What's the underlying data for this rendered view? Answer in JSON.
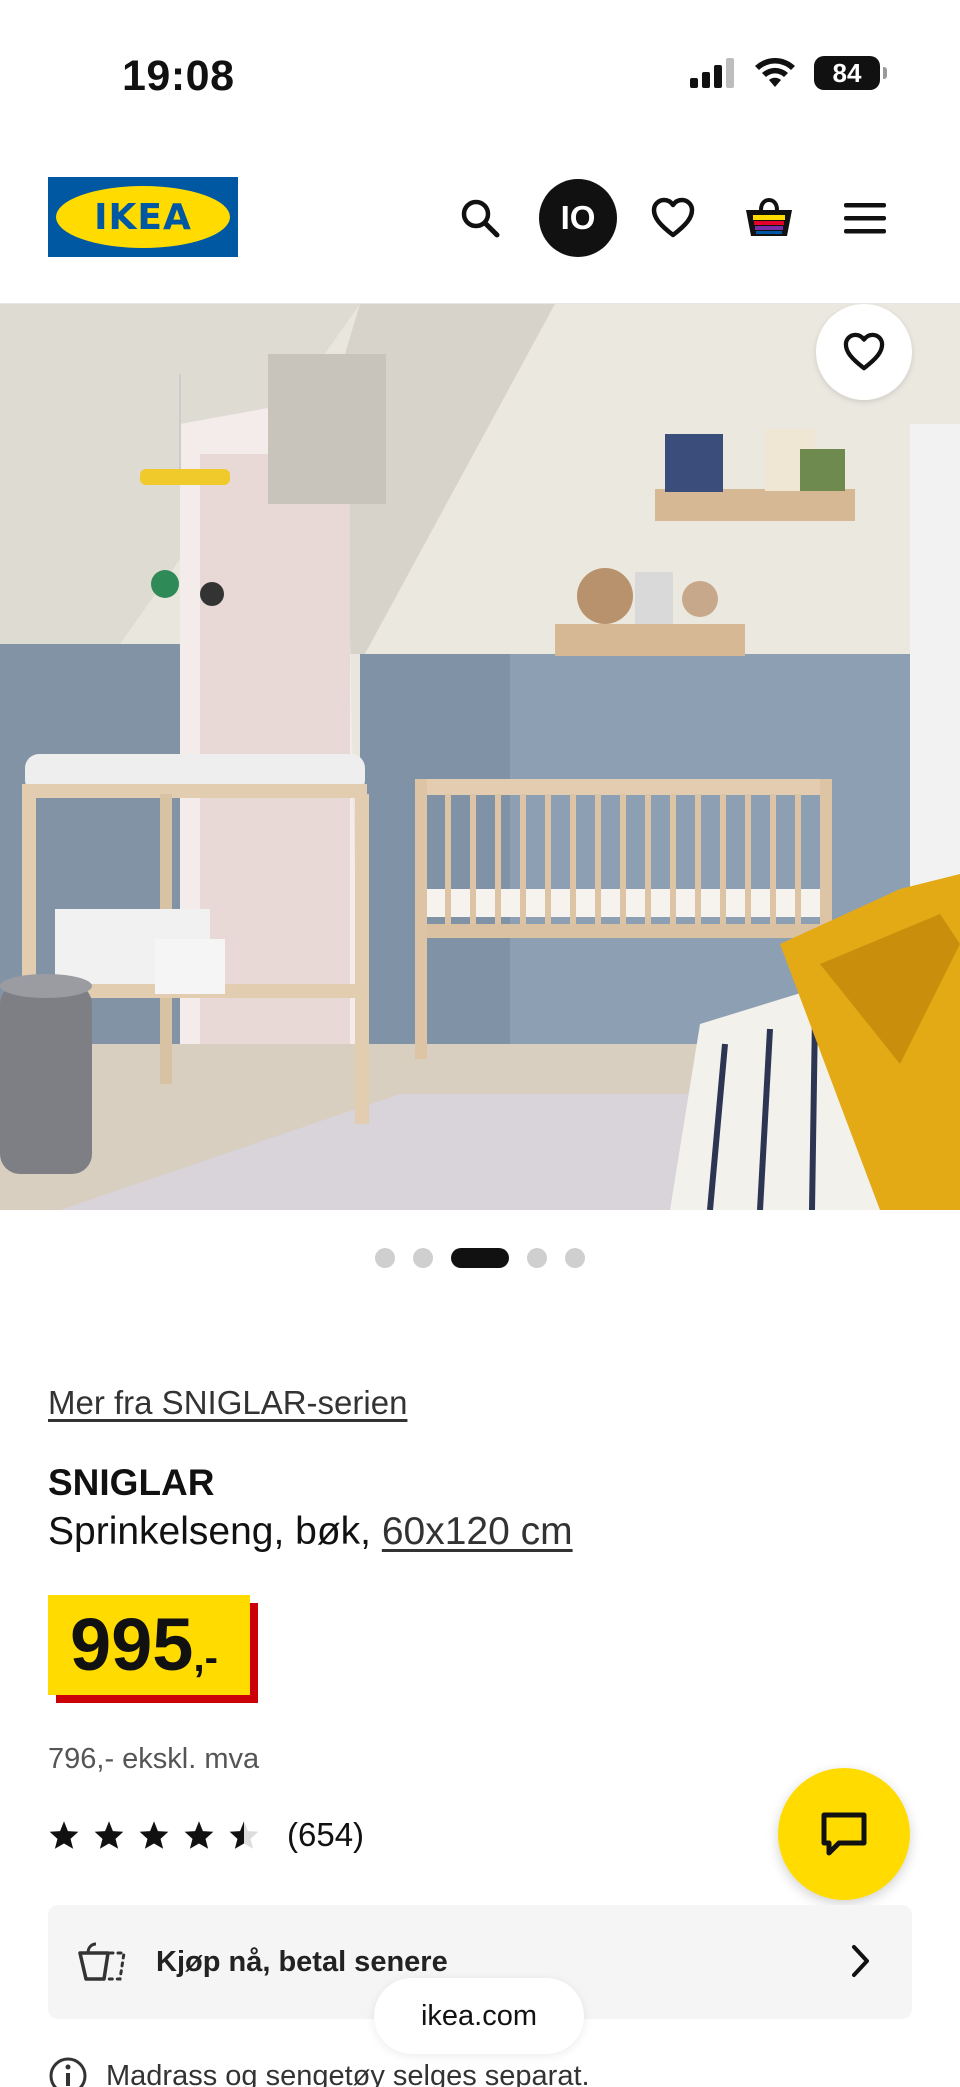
{
  "status_bar": {
    "time": "19:08",
    "battery": "84"
  },
  "header": {
    "logo_text": "IKEA",
    "avatar_initials": "IO",
    "icons": [
      "search-icon",
      "heart-icon",
      "basket-icon",
      "menu-icon"
    ]
  },
  "carousel": {
    "count": 5,
    "active_index": 2
  },
  "product": {
    "series_link": "Mer fra SNIGLAR-serien",
    "name": "SNIGLAR",
    "description": "Sprinkelseng, bøk, ",
    "size_link": "60x120 cm",
    "price": "995",
    "price_suffix": ",-",
    "price_excl_vat": "796,- ekskl. mva",
    "rating_value": 4.5,
    "rating_max": 5,
    "rating_count": "(654)"
  },
  "bnpl": {
    "label": "Kjøp nå, betal senere"
  },
  "browser": {
    "url": "ikea.com"
  },
  "note": {
    "text": "Madrass og sengetøy selges separat."
  },
  "colors": {
    "ikea_blue": "#0058a3",
    "ikea_yellow": "#ffdb00",
    "price_red": "#cc0008"
  }
}
